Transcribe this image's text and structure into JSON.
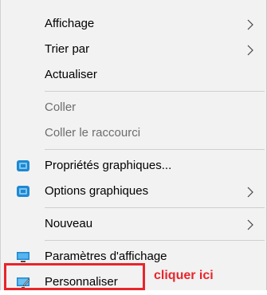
{
  "menu": {
    "view": {
      "label": "Affichage"
    },
    "sort_by": {
      "label": "Trier par"
    },
    "refresh": {
      "label": "Actualiser"
    },
    "paste": {
      "label": "Coller"
    },
    "paste_shortcut": {
      "label": "Coller le raccourci"
    },
    "graphics_properties": {
      "label": "Propriétés graphiques...",
      "icon": "intel-graphics-icon"
    },
    "graphics_options": {
      "label": "Options graphiques",
      "icon": "intel-graphics-icon"
    },
    "new": {
      "label": "Nouveau"
    },
    "display_settings": {
      "label": "Paramètres d'affichage",
      "icon": "display-monitor-icon"
    },
    "personalize": {
      "label": "Personnaliser",
      "icon": "personalize-icon"
    }
  },
  "annotation": {
    "text": "cliquer ici"
  },
  "colors": {
    "menu_background": "#f2f2f2",
    "disabled_text": "#6d6d6d",
    "annotation_red": "#e8252b",
    "icon_blue": "#1e88d2"
  }
}
